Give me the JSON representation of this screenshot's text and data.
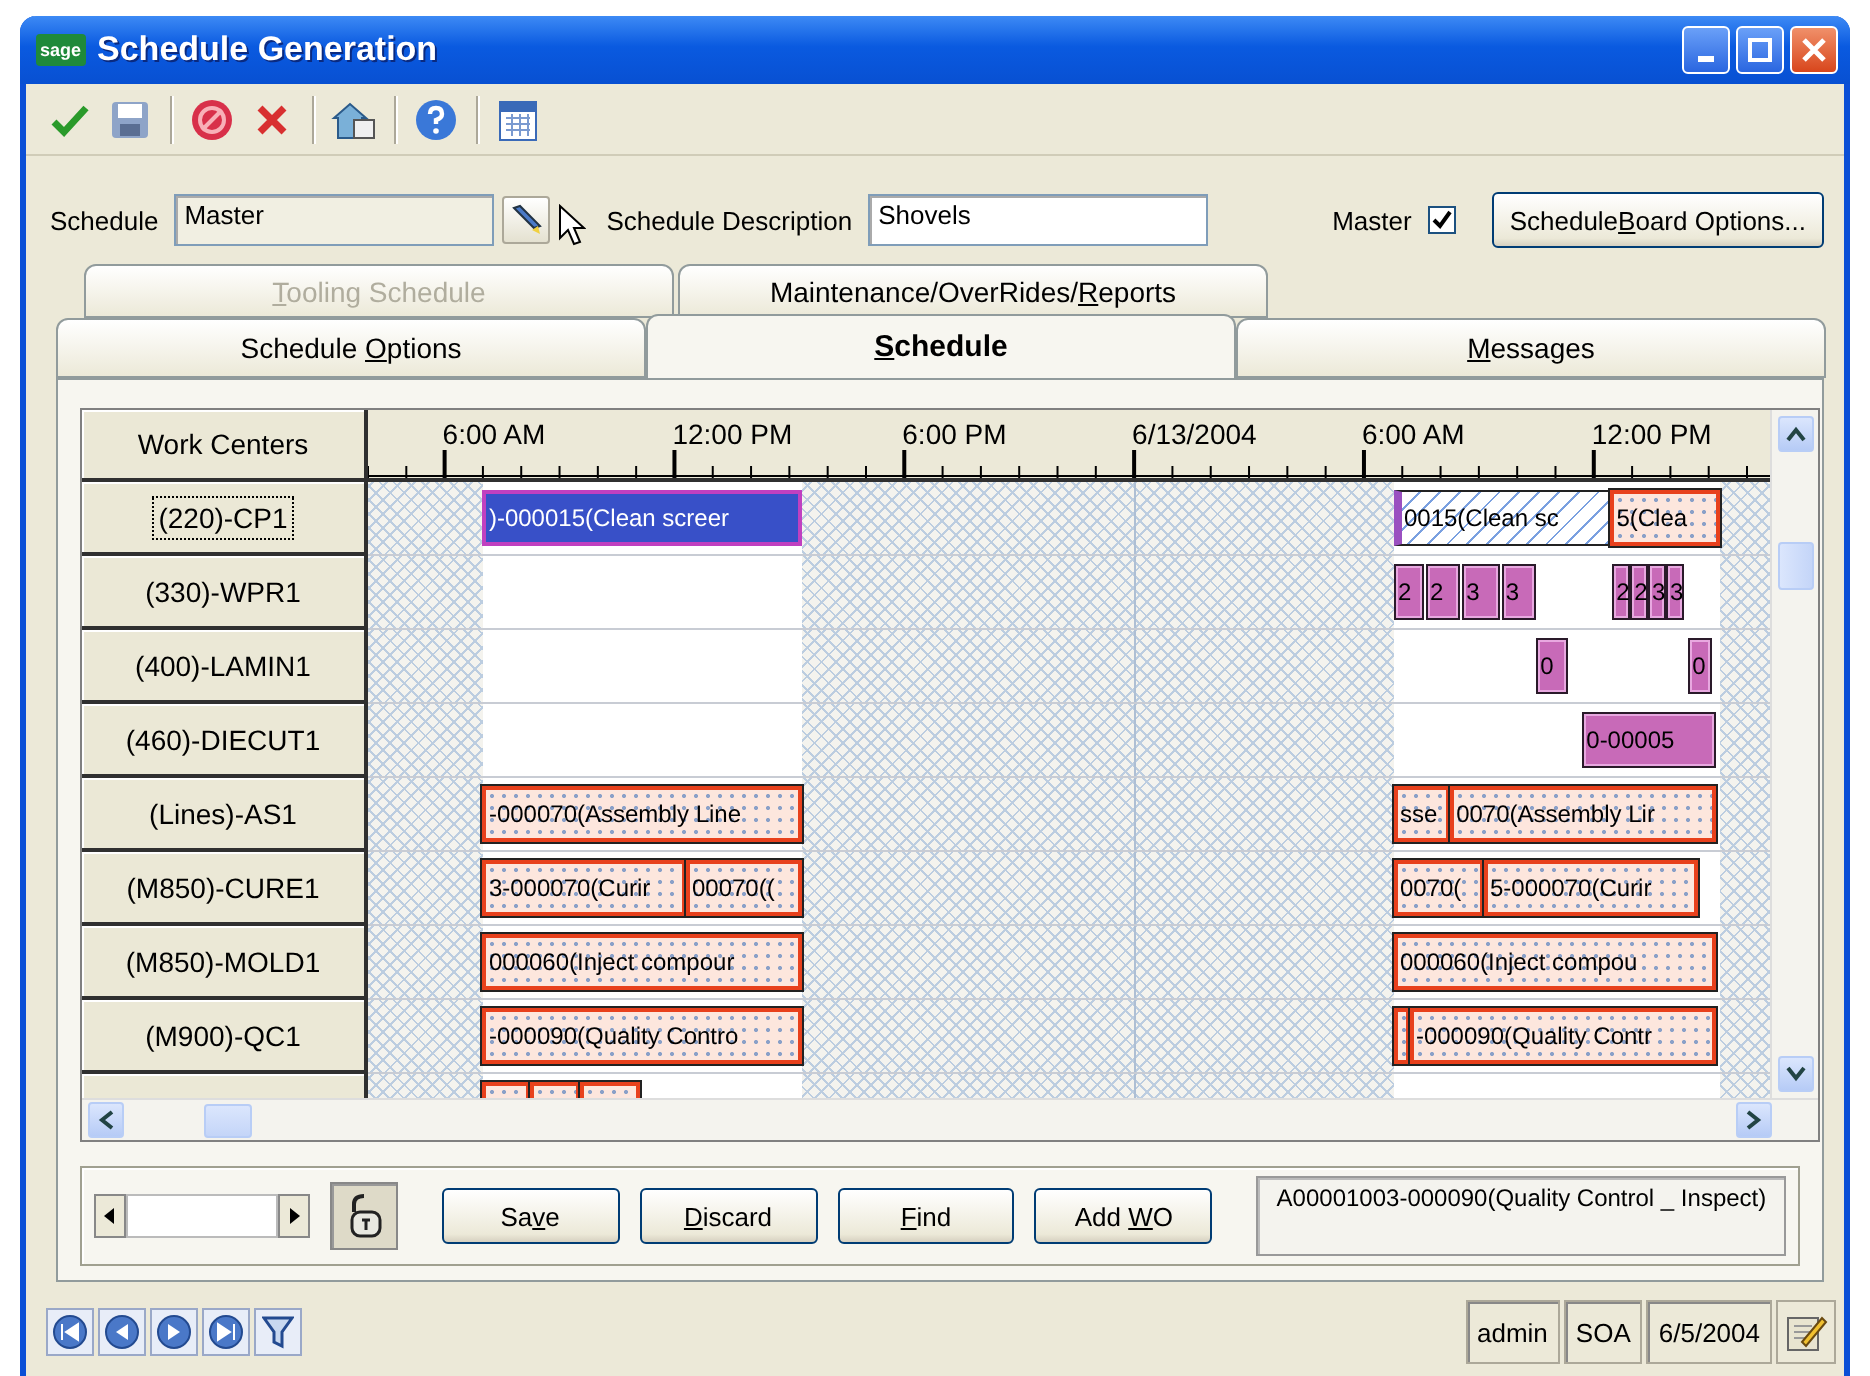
{
  "window": {
    "logo": "sage",
    "title": "Schedule Generation"
  },
  "toolbar": [
    {
      "kind": "accept"
    },
    {
      "kind": "save"
    },
    {
      "kind": "separator"
    },
    {
      "kind": "stop"
    },
    {
      "kind": "delete"
    },
    {
      "kind": "separator"
    },
    {
      "kind": "house"
    },
    {
      "kind": "separator"
    },
    {
      "kind": "help"
    },
    {
      "kind": "separator"
    },
    {
      "kind": "calendar"
    }
  ],
  "form": {
    "schedule": {
      "label": "Schedule",
      "value": "Master"
    },
    "description": {
      "label": "Schedule Description",
      "value": "Shovels"
    },
    "master": {
      "label": "Master",
      "checked": true
    },
    "options_button": {
      "parts": [
        {
          "text": "Schedule",
          "underline": false
        },
        {
          "text": "B",
          "underline": true
        },
        {
          "text": "oard Options...",
          "underline": false
        }
      ]
    }
  },
  "tabs": {
    "back": [
      {
        "parts": [
          {
            "text": "T",
            "underline": true
          },
          {
            "text": "ooling Schedule",
            "underline": false
          }
        ],
        "disabled": true,
        "selected": false
      },
      {
        "parts": [
          {
            "text": "Maintenance/OverRides/",
            "underline": false
          },
          {
            "text": "R",
            "underline": true
          },
          {
            "text": "eports",
            "underline": false
          }
        ],
        "disabled": false,
        "selected": false
      }
    ],
    "front": [
      {
        "parts": [
          {
            "text": "Schedule ",
            "underline": false
          },
          {
            "text": "O",
            "underline": true
          },
          {
            "text": "ptions",
            "underline": false
          }
        ],
        "disabled": false,
        "selected": false
      },
      {
        "parts": [
          {
            "text": "S",
            "underline": true
          },
          {
            "text": "chedule",
            "underline": false
          }
        ],
        "disabled": false,
        "selected": true
      },
      {
        "parts": [
          {
            "text": "M",
            "underline": true
          },
          {
            "text": "essages",
            "underline": false
          }
        ],
        "disabled": false,
        "selected": false
      }
    ]
  },
  "schedule_board": {
    "column_header": "Work Centers",
    "time_labels": [
      "6:00 AM",
      "12:00 PM",
      "6:00 PM",
      "6/13/2004",
      "6:00 AM",
      "12:00 PM"
    ],
    "rows": [
      {
        "label": "(220)-CP1",
        "selected": true,
        "bars": [
          {
            "text": ")-000015(Clean screer",
            "kind": "work_order",
            "selected": true
          },
          {
            "text": "0015(Clean sc",
            "kind": "pending",
            "selected": false
          },
          {
            "text": "5(Clea",
            "kind": "work_order",
            "selected": false
          }
        ]
      },
      {
        "label": "(330)-WPR1",
        "selected": false,
        "bars": [
          {
            "text": "2",
            "kind": "tooling",
            "selected": false
          },
          {
            "text": "2",
            "kind": "tooling",
            "selected": false
          },
          {
            "text": "3",
            "kind": "tooling",
            "selected": false
          },
          {
            "text": "3",
            "kind": "tooling",
            "selected": false
          },
          {
            "text": "2",
            "kind": "tooling",
            "selected": false
          },
          {
            "text": "2",
            "kind": "tooling",
            "selected": false
          },
          {
            "text": "3",
            "kind": "tooling",
            "selected": false
          },
          {
            "text": "3",
            "kind": "tooling",
            "selected": false
          }
        ]
      },
      {
        "label": "(400)-LAMIN1",
        "selected": false,
        "bars": [
          {
            "text": "0",
            "kind": "tooling",
            "selected": false
          },
          {
            "text": "0",
            "kind": "tooling",
            "selected": false
          }
        ]
      },
      {
        "label": "(460)-DIECUT1",
        "selected": false,
        "bars": [
          {
            "text": "0-00005",
            "kind": "tooling",
            "selected": false
          }
        ]
      },
      {
        "label": "(Lines)-AS1",
        "selected": false,
        "bars": [
          {
            "text": "-000070(Assembly Line",
            "kind": "work_order",
            "selected": false
          },
          {
            "text": "sse",
            "kind": "work_order",
            "selected": false
          },
          {
            "text": "0070(Assembly Lir",
            "kind": "work_order",
            "selected": false
          }
        ]
      },
      {
        "label": "(M850)-CURE1",
        "selected": false,
        "bars": [
          {
            "text": "3-000070(Curir",
            "kind": "work_order",
            "selected": false
          },
          {
            "text": "00070((",
            "kind": "work_order",
            "selected": false
          },
          {
            "text": "0070(",
            "kind": "work_order",
            "selected": false
          },
          {
            "text": "5-000070(Curir",
            "kind": "work_order",
            "selected": false
          }
        ]
      },
      {
        "label": "(M850)-MOLD1",
        "selected": false,
        "bars": [
          {
            "text": "000060(Inject compour",
            "kind": "work_order",
            "selected": false
          },
          {
            "text": "000060(Inject compou",
            "kind": "work_order",
            "selected": false
          }
        ]
      },
      {
        "label": "(M900)-QC1",
        "selected": false,
        "bars": [
          {
            "text": "-000090(Quality Contro",
            "kind": "work_order",
            "selected": false
          },
          {
            "kind": "work_order",
            "selected": false
          },
          {
            "text": "-000090(Quality Contr",
            "kind": "work_order",
            "selected": false
          }
        ]
      },
      {
        "bars": [
          {
            "kind": "work_order",
            "selected": false
          },
          {
            "kind": "work_order",
            "selected": false
          },
          {
            "kind": "work_order",
            "selected": false
          }
        ]
      }
    ]
  },
  "bottom_bar": {
    "buttons": [
      {
        "parts": [
          {
            "text": "Sa",
            "underline": false
          },
          {
            "text": "v",
            "underline": true
          },
          {
            "text": "e",
            "underline": false
          }
        ]
      },
      {
        "parts": [
          {
            "text": "D",
            "underline": true
          },
          {
            "text": "iscard",
            "underline": false
          }
        ]
      },
      {
        "parts": [
          {
            "text": "F",
            "underline": true
          },
          {
            "text": "ind",
            "underline": false
          }
        ]
      },
      {
        "parts": [
          {
            "text": "Add ",
            "underline": false
          },
          {
            "text": "W",
            "underline": true
          },
          {
            "text": "O",
            "underline": false
          }
        ]
      }
    ],
    "info": "A00001003-000090(Quality Control _ Inspect)"
  },
  "status_bar": {
    "fields": [
      "admin",
      "SOA",
      "6/5/2004"
    ]
  }
}
